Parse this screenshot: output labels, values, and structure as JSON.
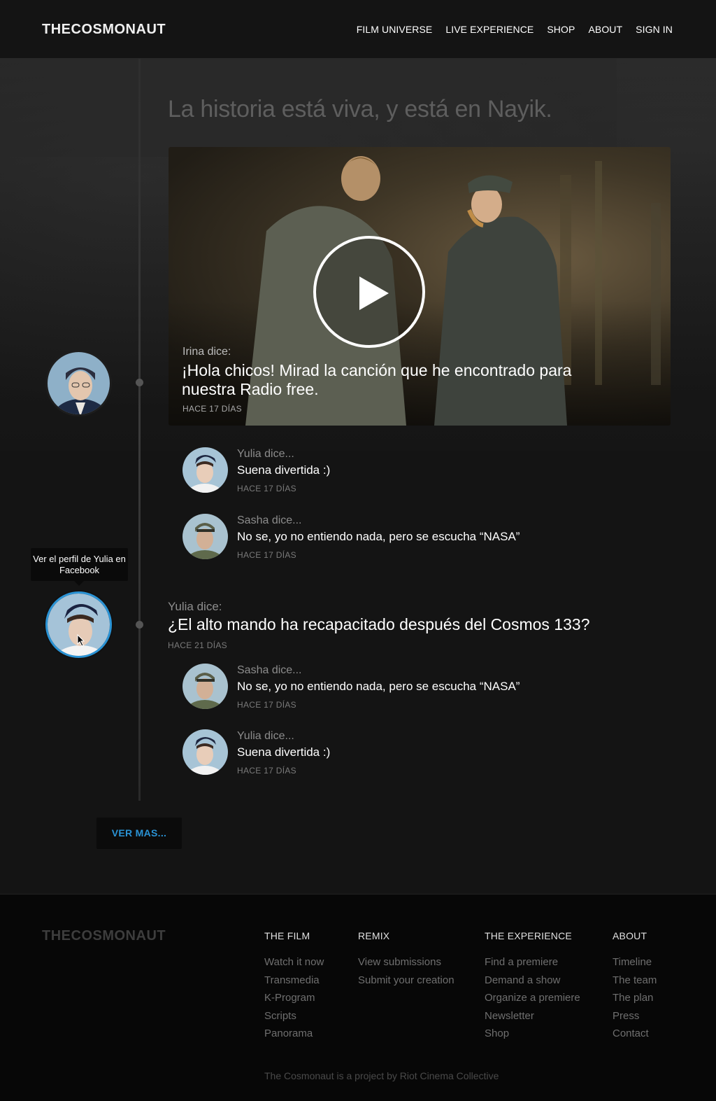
{
  "header": {
    "logo": "THECOSMONAUT",
    "nav": [
      "FILM UNIVERSE",
      "LIVE EXPERIENCE",
      "SHOP",
      "ABOUT",
      "SIGN IN"
    ]
  },
  "headline": "La historia está viva, y está en Nayik.",
  "video_post": {
    "author": "Irina dice:",
    "message": "¡Hola chicos! Mirad la canción que he encontrado para nuestra Radio free.",
    "time": "HACE 17 DÍAS",
    "icon": "play-icon"
  },
  "comments_1": [
    {
      "author": "Yulia dice...",
      "text": "Suena divertida :)",
      "time": "HACE 17 DÍAS"
    },
    {
      "author": "Sasha dice...",
      "text": "No se, yo no entiendo nada, pero se escucha “NASA”",
      "time": "HACE 17 DÍAS"
    }
  ],
  "tooltip": "Ver el perfil de Yulia en Facebook",
  "text_post": {
    "author": "Yulia dice:",
    "message": "¿El alto mando ha recapacitado después del Cosmos 133?",
    "time": "HACE 21 DÍAS"
  },
  "comments_2": [
    {
      "author": "Sasha dice...",
      "text": "No se, yo no entiendo nada, pero se escucha “NASA”",
      "time": "HACE 17 DÍAS"
    },
    {
      "author": "Yulia dice...",
      "text": "Suena divertida :)",
      "time": "HACE 17 DÍAS"
    }
  ],
  "ver_mas": "VER MAS...",
  "footer": {
    "logo": "THECOSMONAUT",
    "columns": [
      {
        "heading": "THE FILM",
        "links": [
          "Watch it now",
          "Transmedia",
          "K-Program",
          "Scripts",
          "Panorama"
        ]
      },
      {
        "heading": "REMIX",
        "links": [
          "View submissions",
          "Submit your creation"
        ]
      },
      {
        "heading": "THE EXPERIENCE",
        "links": [
          "Find a premiere",
          "Demand a show",
          "Organize a premiere",
          "Newsletter",
          "Shop"
        ]
      },
      {
        "heading": "ABOUT",
        "links": [
          "Timeline",
          "The team",
          "The plan",
          "Press",
          "Contact"
        ]
      }
    ],
    "credit": "The Cosmonaut is a project by Riot Cinema Collective"
  },
  "colors": {
    "accent": "#2a93d5",
    "background": "#141414",
    "footer": "#070707"
  }
}
